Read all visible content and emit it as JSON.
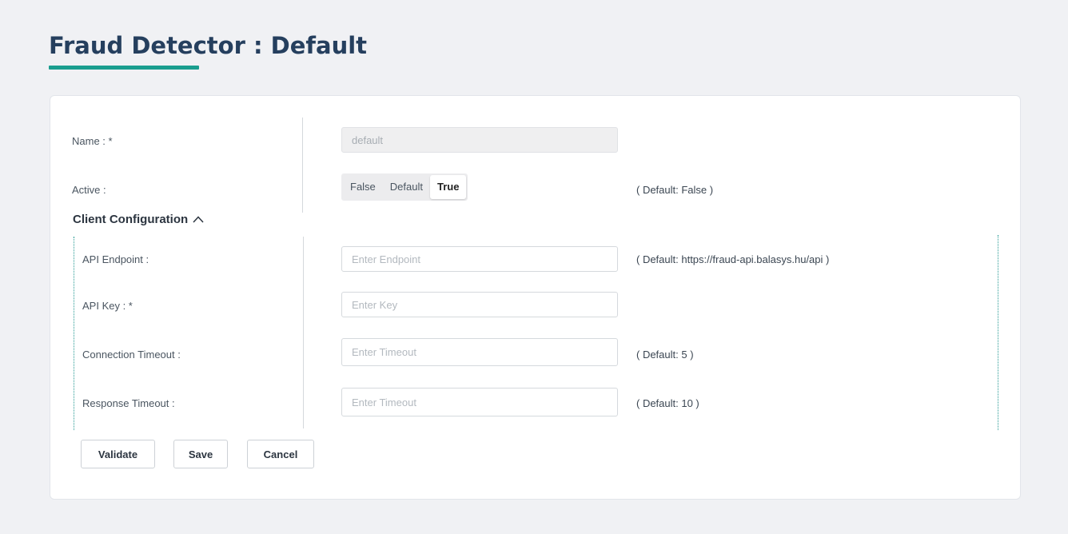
{
  "page": {
    "title": "Fraud Detector : Default"
  },
  "form": {
    "name": {
      "label": "Name : *",
      "value": "default"
    },
    "active": {
      "label": "Active :",
      "options": [
        "False",
        "Default",
        "True"
      ],
      "selected": "True",
      "hint": "( Default: False )"
    }
  },
  "client_config": {
    "title": "Client Configuration",
    "expanded": true,
    "fields": {
      "api_endpoint": {
        "label": "API Endpoint :",
        "placeholder": "Enter Endpoint",
        "hint": "( Default: https://fraud-api.balasys.hu/api )"
      },
      "api_key": {
        "label": "API Key : *",
        "placeholder": "Enter Key"
      },
      "connection_timeout": {
        "label": "Connection Timeout :",
        "placeholder": "Enter Timeout",
        "hint": "( Default: 5 )"
      },
      "response_timeout": {
        "label": "Response Timeout :",
        "placeholder": "Enter Timeout",
        "hint": "( Default: 10 )"
      }
    }
  },
  "actions": {
    "validate": "Validate",
    "save": "Save",
    "cancel": "Cancel"
  },
  "colors": {
    "title": "#253f5e",
    "accent": "#1a9e8f"
  }
}
